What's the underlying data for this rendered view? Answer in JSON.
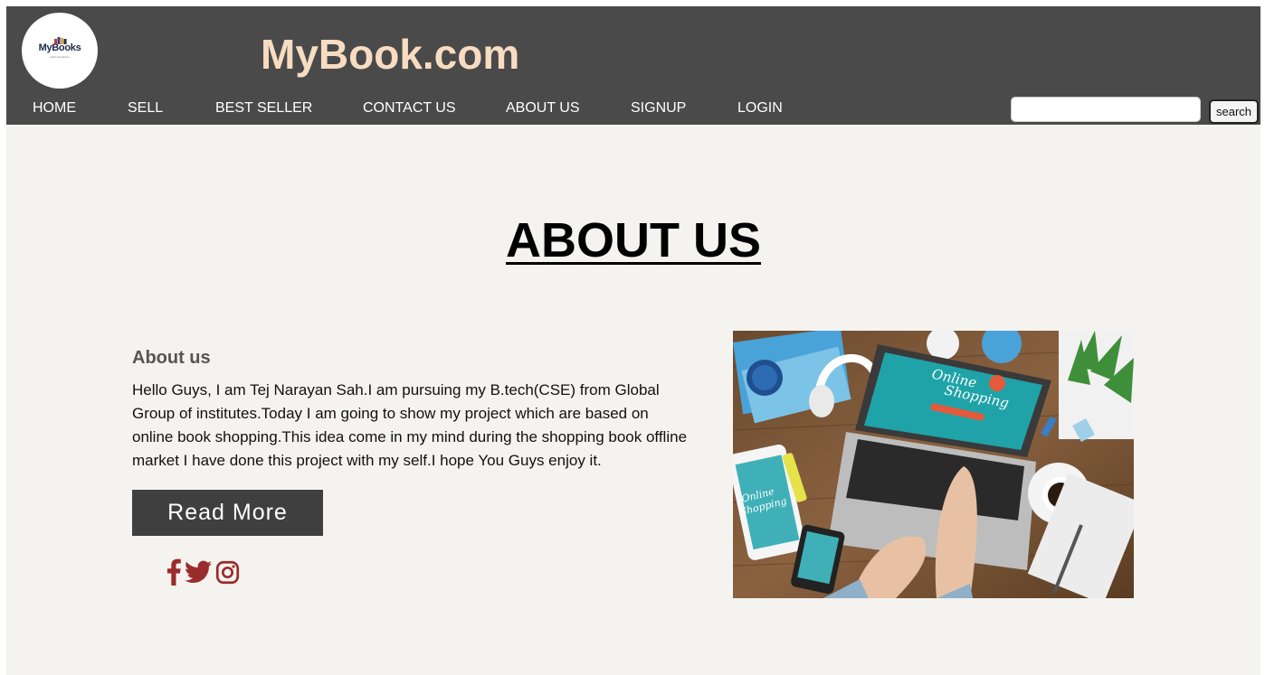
{
  "site": {
    "logo_text": "MyBooks",
    "logo_subtext": "online bookstore",
    "title": "MyBook.com"
  },
  "nav": {
    "items": [
      "HOME",
      "SELL",
      "BEST SELLER",
      "CONTACT US",
      "ABOUT US",
      "SIGNUP",
      "LOGIN"
    ]
  },
  "search": {
    "value": "",
    "placeholder": "",
    "button_label": "search"
  },
  "main": {
    "heading": "ABOUT US",
    "subheading": "About us",
    "body": "Hello Guys, I am Tej Narayan Sah.I am pursuing my B.tech(CSE) from Global Group of institutes.Today I am going to show my project which are based on online book shopping.This idea come in my mind during the shopping book offline market I have done this project with my self.I hope You Guys enjoy it.",
    "read_more_label": "Read More",
    "social_icons": [
      "facebook-icon",
      "twitter-icon",
      "instagram-icon"
    ]
  },
  "hero_image": {
    "screen_text_1": "Online",
    "screen_text_2": "Shopping",
    "tablet_text_1": "Online",
    "tablet_text_2": "Shopping"
  },
  "colors": {
    "topbar": "#4a4a4a",
    "title": "#f7dcc1",
    "page_bg": "#f5f3ef",
    "button_bg": "#3f3f3f",
    "social": "#9b2c2c"
  }
}
